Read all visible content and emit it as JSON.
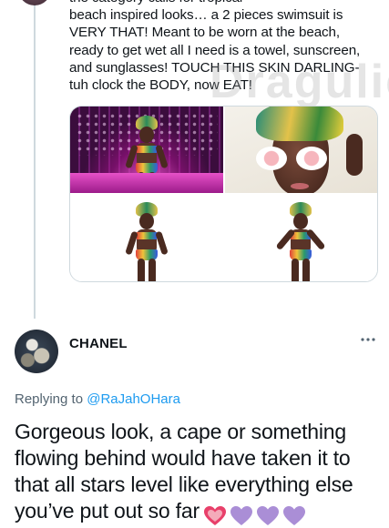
{
  "thread": {
    "tweet_text": "the category calls for tropical\nbeach inspired looks… a 2 pieces swimsuit is\nVERY THAT!  Meant to be worn at the beach,\nready to get wet all I need is a towel, sunscreen,\nand sunglasses! TOUCH THIS SKIN DARLING-\ntuh  clock the BODY, now EAT!",
    "watermark": "Dragulicious",
    "media": [
      {
        "kind": "runway-stage"
      },
      {
        "kind": "portrait-sunglasses"
      },
      {
        "kind": "full-body-pose"
      },
      {
        "kind": "full-body-pose"
      }
    ]
  },
  "reply": {
    "name": "CHANEL",
    "replying_prefix": "Replying to ",
    "replying_handle": "@RaJahOHara",
    "text": "Gorgeous look, a cape or something flowing behind would have taken it to that all stars level like everything else you’ve put out so far",
    "emojis": [
      "sparkling-heart",
      "purple-heart",
      "purple-heart",
      "purple-heart"
    ]
  },
  "colors": {
    "link": "#1d9bf0",
    "secondary_text": "#536471",
    "thread_line": "#cfd9de",
    "purple_heart": "#aa8ed6",
    "pink_heart": "#f4abba"
  }
}
